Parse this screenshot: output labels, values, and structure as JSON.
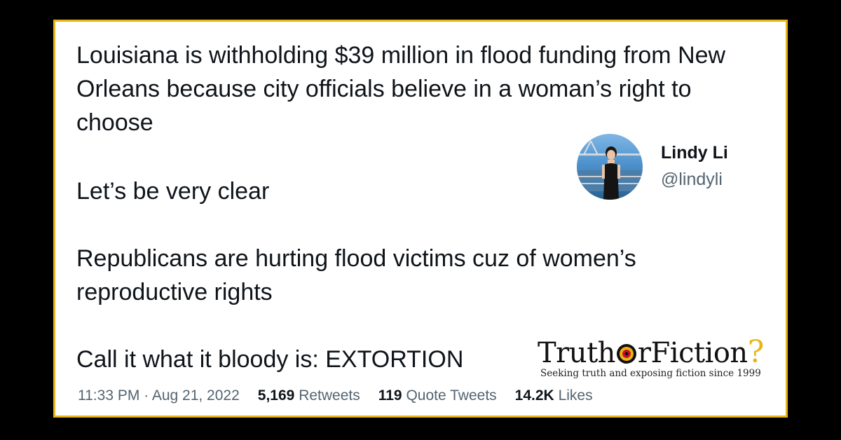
{
  "tweet": {
    "paragraphs": [
      "Louisiana is withholding $39 million in flood funding from New Orleans because city officials believe in a woman’s right to choose",
      "Let’s be very clear",
      "Republicans are hurting flood victims cuz of women’s reproductive rights",
      "Call it what it bloody is: EXTORTION"
    ],
    "author": {
      "name": "Lindy Li",
      "handle": "@lindyli"
    },
    "meta": {
      "time": "11:33 PM · Aug 21, 2022",
      "retweets_count": "5,169",
      "retweets_label": "Retweets",
      "quotes_count": "119",
      "quotes_label": "Quote Tweets",
      "likes_count": "14.2K",
      "likes_label": "Likes"
    }
  },
  "logo": {
    "text_before": "Truth",
    "text_after": "rFiction",
    "question_mark": "?",
    "tagline": "Seeking truth and exposing fiction since 1999"
  },
  "colors": {
    "border": "#e8b517",
    "background": "#000000",
    "secondary_text": "#536471",
    "target_red": "#c8102e"
  }
}
